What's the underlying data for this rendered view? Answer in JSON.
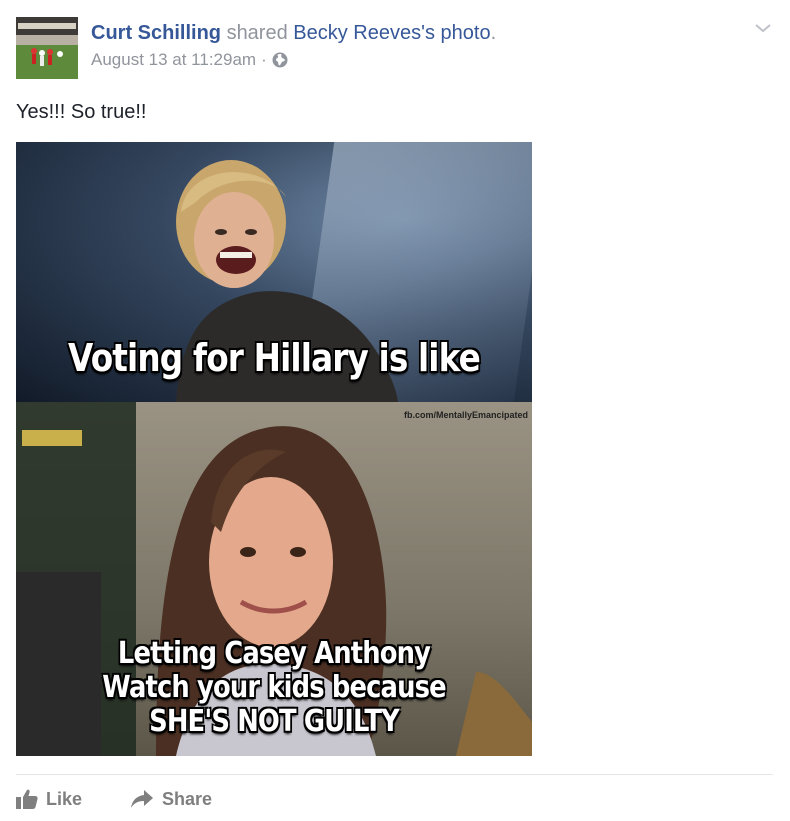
{
  "post": {
    "author": "Curt Schilling",
    "verb": "shared",
    "shared_owner": "Becky Reeves",
    "shared_owner_suffix": "'s",
    "shared_object": "photo",
    "period": ".",
    "timestamp": "August 13 at 11:29am",
    "meta_separator": "·",
    "privacy_icon": "globe-icon",
    "text": "Yes!!! So true!!"
  },
  "photo": {
    "caption_top": "Voting for Hillary is like",
    "caption_bottom_line1": "Letting Casey Anthony",
    "caption_bottom_line2": "Watch your kids because",
    "caption_bottom_line3": "SHE'S NOT GUILTY",
    "watermark": "fb.com/MentallyEmancipated"
  },
  "actions": {
    "like_label": "Like",
    "like_icon": "thumbs-up-icon",
    "share_label": "Share",
    "share_icon": "share-arrow-icon"
  },
  "colors": {
    "link": "#365899",
    "secondary_text": "#90949c",
    "action_text": "#7f7f7f",
    "divider": "#e5e5e5"
  }
}
